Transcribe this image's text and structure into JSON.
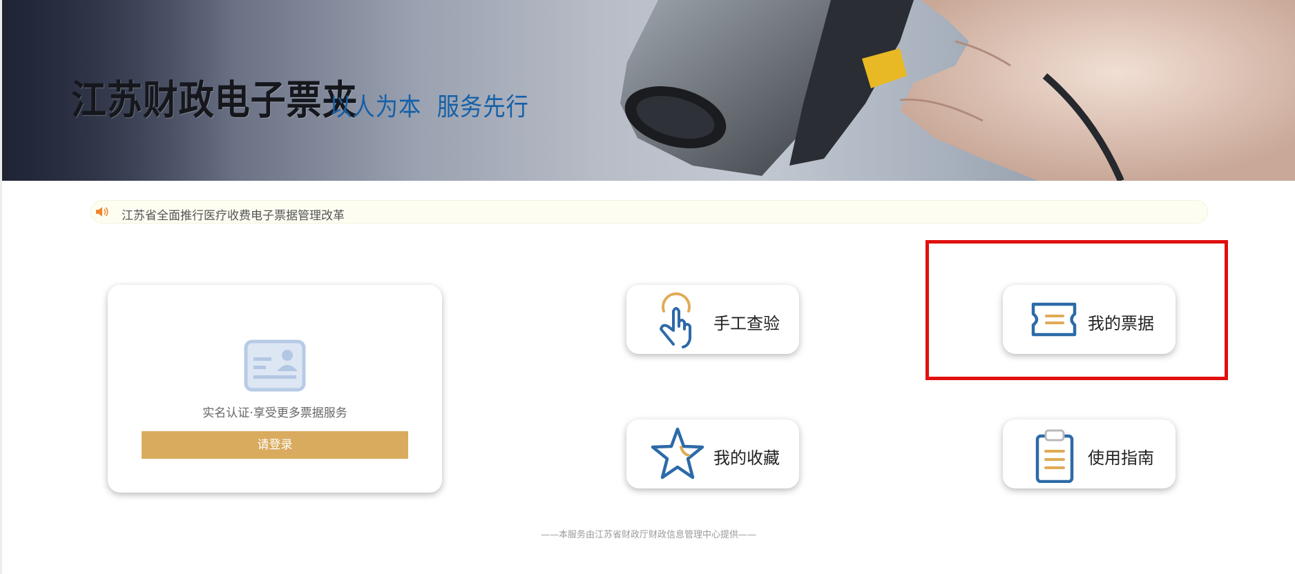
{
  "banner": {
    "title": "江苏财政电子票夹",
    "slogan": "以人为本  服务先行"
  },
  "notice": {
    "icon": "speaker-icon",
    "text": "江苏省全面推行医疗收费电子票据管理改革"
  },
  "login": {
    "icon": "id-card-icon",
    "hint": "实名认证·享受更多票据服务",
    "button_label": "请登录"
  },
  "tiles": [
    {
      "icon": "hand-tap-icon",
      "label": "手工查验"
    },
    {
      "icon": "ticket-icon",
      "label": "我的票据"
    },
    {
      "icon": "star-icon",
      "label": "我的收藏"
    },
    {
      "icon": "clipboard-icon",
      "label": "使用指南"
    }
  ],
  "footer": {
    "text": "——本服务由江苏省财政厅财政信息管理中心提供——"
  },
  "colors": {
    "accent_gold": "#d9ab5e",
    "icon_blue": "#2d6aa8",
    "slogan_blue": "#1560a8",
    "highlight_red": "#e01010"
  }
}
